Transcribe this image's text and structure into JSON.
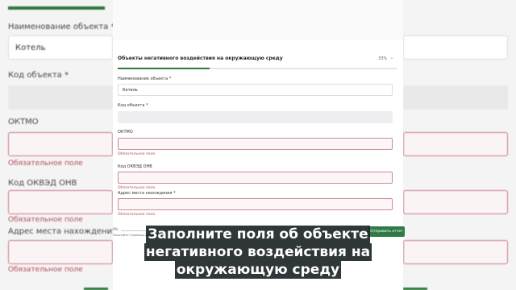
{
  "background": {
    "fields": [
      {
        "label": "Наименование объекта *",
        "value": "Котель",
        "state": "filled"
      },
      {
        "label": "Код объекта *",
        "value": "",
        "state": "empty"
      },
      {
        "label": "ОКТМО",
        "value": "",
        "state": "error"
      },
      {
        "label": "Код ОКВЭД ОНВ",
        "value": "",
        "state": "error"
      },
      {
        "label": "Адрес места нахождения *",
        "value": "",
        "state": "error"
      }
    ],
    "error_text": "Обязательное поле"
  },
  "modal": {
    "section_title": "Объекты негативного воздействия на окружающую среду",
    "progress_percent": "33%",
    "progress_fraction": 0.33,
    "fields": {
      "name_label": "Наименование объекта *",
      "name_value": "Котель",
      "code_label": "Код объекта *",
      "oktmo_label": "ОКТМО",
      "oktmo_error": "Обязательное поле",
      "okved_label": "Код ОКВЭД ОНВ",
      "okved_error": "Обязательное поле",
      "address_label": "Адрес места нахождения *",
      "address_error": "Обязательное поле"
    },
    "footer": {
      "percent": "0%",
      "hint": "Пользуйте страницы для перемещения",
      "send_label": "Отправить отчет"
    }
  },
  "caption": {
    "lines": [
      "Заполните поля об объекте",
      "негативного воздействия на",
      "окружающую среду"
    ]
  },
  "colors": {
    "accent_green": "#2c7a3a",
    "error_red": "#b34a55"
  }
}
